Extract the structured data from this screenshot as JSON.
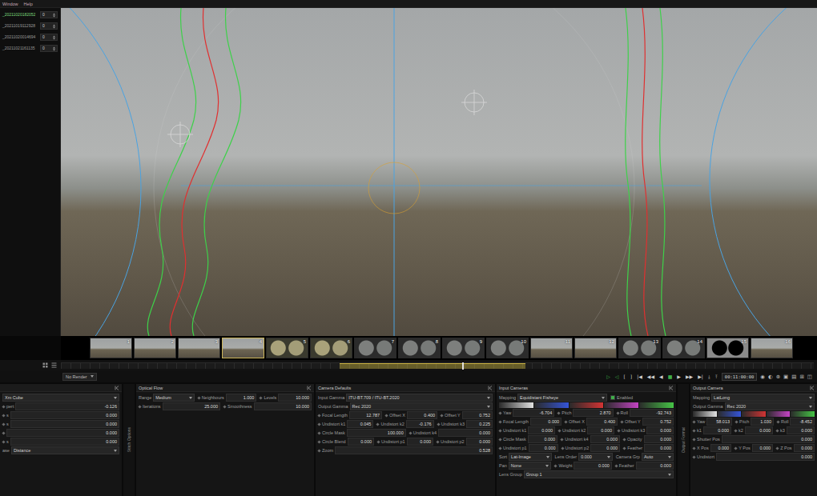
{
  "menu": [
    {
      "label": "Window"
    },
    {
      "label": "Help"
    }
  ],
  "clips": [
    {
      "name": "_20211020182052",
      "value": "0",
      "selected": true
    },
    {
      "name": "_20211019112928",
      "value": "0",
      "selected": false
    },
    {
      "name": "_20211020014694",
      "value": "0",
      "selected": false
    },
    {
      "name": "_20211021161135",
      "value": "0",
      "selected": false
    }
  ],
  "thumbnails": [
    {
      "number": "1",
      "kind": "scene",
      "selected": false
    },
    {
      "number": "2",
      "kind": "scene",
      "selected": false
    },
    {
      "number": "3",
      "kind": "scene",
      "selected": false
    },
    {
      "number": "4",
      "kind": "scene",
      "selected": true
    },
    {
      "number": "5",
      "kind": "warm",
      "selected": false
    },
    {
      "number": "6",
      "kind": "warm",
      "selected": false
    },
    {
      "number": "7",
      "kind": "fisheye",
      "selected": false
    },
    {
      "number": "8",
      "kind": "fisheye",
      "selected": false
    },
    {
      "number": "9",
      "kind": "fisheye",
      "selected": false
    },
    {
      "number": "10",
      "kind": "fisheye",
      "selected": false
    },
    {
      "number": "11",
      "kind": "scene",
      "selected": false
    },
    {
      "number": "12",
      "kind": "scene",
      "selected": false
    },
    {
      "number": "13",
      "kind": "fisheye",
      "selected": false
    },
    {
      "number": "14",
      "kind": "fisheye",
      "selected": false
    },
    {
      "number": "15",
      "kind": "mask",
      "selected": false
    },
    {
      "number": "16",
      "kind": "scene",
      "selected": false
    }
  ],
  "timeline": {
    "range_start": 0.37,
    "range_end": 0.617,
    "playhead": 0.533
  },
  "transport": {
    "render_mode": "No Render",
    "buttons": [
      {
        "glyph": "▷",
        "color": "#3fae49"
      },
      {
        "glyph": "◁",
        "color": "#3fae49"
      },
      {
        "glyph": "[",
        "color": "#cfcfcf"
      },
      {
        "glyph": "]",
        "color": "#cfcfcf"
      },
      {
        "glyph": "|◀",
        "color": "#cfcfcf"
      },
      {
        "glyph": "◀◀",
        "color": "#cfcfcf"
      },
      {
        "glyph": "◀",
        "color": "#cfcfcf"
      },
      {
        "glyph": "■",
        "color": "#3fae49"
      },
      {
        "glyph": "▶",
        "color": "#cfcfcf"
      },
      {
        "glyph": "▶▶",
        "color": "#cfcfcf"
      },
      {
        "glyph": "▶|",
        "color": "#cfcfcf"
      },
      {
        "glyph": "⤓",
        "color": "#cfcfcf"
      },
      {
        "glyph": "⤒",
        "color": "#cfcfcf"
      }
    ],
    "timecode": "00:11:00:00",
    "right_icons": [
      {
        "glyph": "◉"
      },
      {
        "glyph": "◐"
      },
      {
        "glyph": "⊕"
      },
      {
        "glyph": "▣"
      },
      {
        "glyph": "▤"
      },
      {
        "glyph": "⊞"
      },
      {
        "glyph": "◫"
      }
    ]
  },
  "panels": [
    {
      "kind": "panel",
      "title": "",
      "rows": [
        [
          {
            "kind": "dropdown",
            "label": "",
            "value": "Xm Cube"
          }
        ],
        [
          {
            "kind": "field",
            "label": "pert",
            "value": "-0.126"
          }
        ],
        [
          {
            "kind": "field",
            "label": "s",
            "value": "0.000"
          }
        ],
        [
          {
            "kind": "field",
            "label": "s",
            "value": "0.000"
          }
        ],
        [
          {
            "kind": "field",
            "label": "",
            "value": "0.000"
          }
        ],
        [
          {
            "kind": "field",
            "label": "s",
            "value": "0.000"
          }
        ],
        [
          {
            "kind": "dropdown",
            "label": "ase",
            "value": "Distance"
          }
        ]
      ]
    },
    {
      "kind": "strip",
      "title": "Stitch Options"
    },
    {
      "kind": "panel",
      "title": "Optical Flow",
      "rows": [
        [
          {
            "kind": "dropdown",
            "label": "Range",
            "value": "Medium"
          },
          {
            "kind": "field",
            "label": "Neighbours",
            "value": "1.000"
          },
          {
            "kind": "field",
            "label": "Levels",
            "value": "10.000"
          }
        ],
        [
          {
            "kind": "field",
            "label": "Iterations",
            "value": "25.000"
          },
          {
            "kind": "field",
            "label": "Smoothness",
            "value": "10.000"
          }
        ]
      ]
    },
    {
      "kind": "panel",
      "title": "Camera Defaults",
      "rows": [
        [
          {
            "kind": "dropdown",
            "label": "Input Gamma",
            "value": "ITU-BT.709 / ITU-BT.2020"
          }
        ],
        [
          {
            "kind": "dropdown",
            "label": "Output Gamma",
            "value": "Rec 2020"
          }
        ],
        [
          {
            "kind": "field",
            "label": "Focal Length",
            "value": "12.787"
          },
          {
            "kind": "field",
            "label": "Offset X",
            "value": "0.400"
          },
          {
            "kind": "field",
            "label": "Offset Y",
            "value": "0.752"
          }
        ],
        [
          {
            "kind": "field",
            "label": "Undistort k1",
            "value": "0.045"
          },
          {
            "kind": "field",
            "label": "Undistort k2",
            "value": "-0.176"
          },
          {
            "kind": "field",
            "label": "Undistort k3",
            "value": "0.225"
          }
        ],
        [
          {
            "kind": "field",
            "label": "Circle Mask",
            "value": "100.000"
          },
          {
            "kind": "field",
            "label": "Undistort k4",
            "value": "0.000"
          }
        ],
        [
          {
            "kind": "field",
            "label": "Circle Blend",
            "value": "0.000"
          },
          {
            "kind": "field",
            "label": "Undistort p1",
            "value": "0.000"
          },
          {
            "kind": "field",
            "label": "Undistort p2",
            "value": "0.000"
          }
        ],
        [
          {
            "kind": "field",
            "label": "Zoom",
            "value": "0.528"
          }
        ]
      ]
    },
    {
      "kind": "panel",
      "title": "Input Cameras",
      "rows": [
        [
          {
            "kind": "dropdown",
            "label": "Mapping",
            "value": "Equidistant Fisheye"
          },
          {
            "kind": "checkbox",
            "label": "Enabled",
            "checked": true
          }
        ],
        [
          {
            "kind": "colorbar",
            "swatches": [
              {
                "color": "#e2e2e2"
              },
              {
                "color": "#3555d8"
              },
              {
                "color": "#d23434"
              },
              {
                "color": "#c444c4"
              },
              {
                "color": "#46c446"
              }
            ]
          }
        ],
        [
          {
            "kind": "field",
            "label": "Yaw",
            "value": "-6.704"
          },
          {
            "kind": "field",
            "label": "Pitch",
            "value": "2.870"
          },
          {
            "kind": "field",
            "label": "Roll",
            "value": "-92.743"
          }
        ],
        [
          {
            "kind": "field",
            "label": "Focal Length",
            "value": "0.000"
          },
          {
            "kind": "field",
            "label": "Offset X",
            "value": "0.400"
          },
          {
            "kind": "field",
            "label": "Offset Y",
            "value": "0.752"
          }
        ],
        [
          {
            "kind": "field",
            "label": "Undistort k1",
            "value": "0.000"
          },
          {
            "kind": "field",
            "label": "Undistort k2",
            "value": "0.000"
          },
          {
            "kind": "field",
            "label": "Undistort k3",
            "value": "0.000"
          }
        ],
        [
          {
            "kind": "field",
            "label": "Circle Mask",
            "value": "0.000"
          },
          {
            "kind": "field",
            "label": "Undistort k4",
            "value": "0.000"
          },
          {
            "kind": "field",
            "label": "Opacity",
            "value": "0.000"
          }
        ],
        [
          {
            "kind": "field",
            "label": "Undistort p1",
            "value": "0.000"
          },
          {
            "kind": "field",
            "label": "Undistort p2",
            "value": "0.000"
          },
          {
            "kind": "field",
            "label": "Feather",
            "value": "0.000"
          }
        ],
        [
          {
            "kind": "dropdown",
            "label": "Sort",
            "value": "Lat-Image"
          },
          {
            "kind": "dropdown",
            "label": "Lens Order",
            "value": "0.000"
          },
          {
            "kind": "dropdown",
            "label": "Camera Grp",
            "value": "Auto"
          }
        ],
        [
          {
            "kind": "dropdown",
            "label": "Pan",
            "value": "None"
          },
          {
            "kind": "field",
            "label": "Weight",
            "value": "0.000"
          },
          {
            "kind": "field",
            "label": "Feather",
            "value": "0.000"
          }
        ],
        [
          {
            "kind": "dropdown",
            "label": "Lens Group",
            "value": "Group 1"
          }
        ]
      ]
    },
    {
      "kind": "strip",
      "title": "Output Format"
    },
    {
      "kind": "panel",
      "title": "Output Camera",
      "rows": [
        [
          {
            "kind": "dropdown",
            "label": "Mapping",
            "value": "LatLong"
          }
        ],
        [
          {
            "kind": "dropdown",
            "label": "Output Gamma",
            "value": "Rec 2020"
          }
        ],
        [
          {
            "kind": "colorbar",
            "swatches": [
              {
                "color": "#e2e2e2"
              },
              {
                "color": "#3555d8"
              },
              {
                "color": "#d23434"
              },
              {
                "color": "#c444c4"
              },
              {
                "color": "#46c446"
              }
            ]
          }
        ],
        [
          {
            "kind": "field",
            "label": "Yaw",
            "value": "58.013"
          },
          {
            "kind": "field",
            "label": "Pitch",
            "value": "1.030"
          },
          {
            "kind": "field",
            "label": "Roll",
            "value": "-8.452"
          }
        ],
        [
          {
            "kind": "field",
            "label": "k1",
            "value": "0.000"
          },
          {
            "kind": "field",
            "label": "k2",
            "value": "0.000"
          },
          {
            "kind": "field",
            "label": "k3",
            "value": "0.000"
          }
        ],
        [
          {
            "kind": "field",
            "label": "Shutter Pos",
            "value": "0.000"
          }
        ],
        [
          {
            "kind": "field",
            "label": "X Pos",
            "value": "0.000"
          },
          {
            "kind": "field",
            "label": "Y Pos",
            "value": "0.000"
          },
          {
            "kind": "field",
            "label": "Z Pos",
            "value": "0.000"
          }
        ],
        [
          {
            "kind": "field",
            "label": "Undistort",
            "value": "0.000"
          }
        ]
      ]
    }
  ]
}
